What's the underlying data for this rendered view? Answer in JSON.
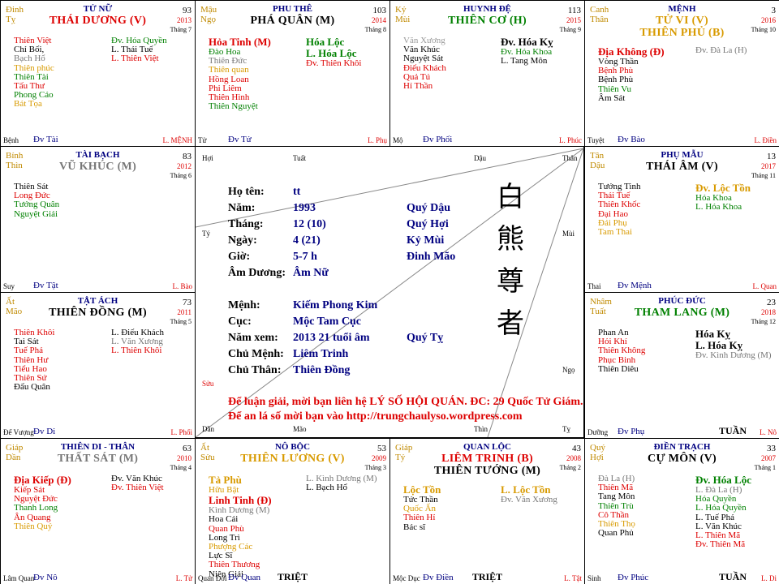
{
  "cells": [
    {
      "id": "tl",
      "can": [
        "Đinh",
        "Tỵ"
      ],
      "house": "TỬ NỮ",
      "main": [
        {
          "t": "THÁI DƯƠNG (V)",
          "c": "red"
        }
      ],
      "age": "93",
      "year": "2013",
      "month": "Tháng 7",
      "left": [
        {
          "t": "Thiên Việt",
          "c": "red"
        },
        {
          "t": "Chỉ Bối,",
          "c": "black"
        },
        {
          "t": "Bạch Hổ",
          "c": "gray"
        },
        {
          "t": "Thiên phúc",
          "c": "orange"
        },
        {
          "t": "Thiên Tài",
          "c": "green"
        },
        {
          "t": "Tấu Thư",
          "c": "red"
        },
        {
          "t": "Phong Cáo",
          "c": "green"
        },
        {
          "t": "Bát Tọa",
          "c": "orange"
        }
      ],
      "right": [
        {
          "t": "Đv. Hóa Quyền",
          "c": "green"
        },
        {
          "t": "L. Thái Tuế",
          "c": "black"
        },
        {
          "t": "L. Thiên Việt",
          "c": "red"
        }
      ],
      "foot": {
        "l": "Bệnh",
        "c": "Đv Tài",
        "r": "L. MỆNH",
        "tu": ""
      }
    },
    {
      "id": "t2",
      "can": [
        "Mậu",
        "Ngọ"
      ],
      "house": "PHU THÊ",
      "main": [
        {
          "t": "PHÁ QUÂN (M)",
          "c": "black"
        }
      ],
      "age": "103",
      "year": "2014",
      "month": "Tháng 8",
      "left": [
        {
          "t": "Hỏa Tinh (M)",
          "c": "red",
          "big": true
        },
        {
          "t": "Đào Hoa",
          "c": "green"
        },
        {
          "t": "Thiên Đức",
          "c": "gray"
        },
        {
          "t": "Thiên quan",
          "c": "orange"
        },
        {
          "t": "Hồng Loan",
          "c": "red"
        },
        {
          "t": "Phi Liêm",
          "c": "red"
        },
        {
          "t": "Thiên Hình",
          "c": "red"
        },
        {
          "t": "Thiên Nguyệt",
          "c": "green"
        }
      ],
      "right": [
        {
          "t": "Hóa Lộc",
          "c": "green",
          "big": true
        },
        {
          "t": "L. Hóa Lộc",
          "c": "green",
          "big": true
        },
        {
          "t": "Đv. Thiên Khôi",
          "c": "red"
        }
      ],
      "foot": {
        "l": "Tử",
        "c": "Đv Tử",
        "r": "L. Phụ",
        "tu": ""
      }
    },
    {
      "id": "t3",
      "can": [
        "Kỷ",
        "Mùi"
      ],
      "house": "HUYNH ĐỆ",
      "main": [
        {
          "t": "THIÊN CƠ (H)",
          "c": "green"
        }
      ],
      "age": "113",
      "year": "2015",
      "month": "Tháng 9",
      "left": [
        {
          "t": "Văn Xương",
          "c": "lgray",
          "big": false
        },
        {
          "t": "Văn Khúc",
          "c": "black"
        },
        {
          "t": "Nguyệt Sát",
          "c": "black"
        },
        {
          "t": "Điếu Khách",
          "c": "red"
        },
        {
          "t": "Quả Tú",
          "c": "red"
        },
        {
          "t": "Hỉ Thần",
          "c": "red"
        }
      ],
      "right": [
        {
          "t": "Đv. Hóa Kỵ",
          "c": "black",
          "big": true
        },
        {
          "t": "Đv. Hóa Khoa",
          "c": "green"
        },
        {
          "t": "L. Tang Môn",
          "c": "black"
        }
      ],
      "foot": {
        "l": "Mộ",
        "c": "Đv Phối",
        "r": "L. Phúc",
        "tu": ""
      }
    },
    {
      "id": "tr",
      "can": [
        "Canh",
        "Thân"
      ],
      "house": "MỆNH",
      "main": [
        {
          "t": "TỬ VI (V)",
          "c": "orange"
        },
        {
          "t": "THIÊN PHỦ (B)",
          "c": "orange"
        }
      ],
      "age": "3",
      "year": "2016",
      "month": "Tháng 10",
      "left": [
        {
          "t": "Địa Không (Đ)",
          "c": "red",
          "big": true
        },
        {
          "t": "Vòng Thần",
          "c": "black"
        },
        {
          "t": "Bệnh Phù",
          "c": "red"
        },
        {
          "t": "Bệnh Phù",
          "c": "black"
        },
        {
          "t": "Thiên Vu",
          "c": "green"
        },
        {
          "t": "Âm Sát",
          "c": "black"
        }
      ],
      "right": [
        {
          "t": "Đv. Đà La (H)",
          "c": "gray"
        }
      ],
      "foot": {
        "l": "Tuyệt",
        "c": "Đv Bào",
        "r": "L. Điền",
        "tu": ""
      }
    },
    {
      "id": "l2",
      "can": [
        "Bính",
        "Thìn"
      ],
      "house": "TÀI BẠCH",
      "main": [
        {
          "t": "VŨ KHÚC (M)",
          "c": "gray"
        }
      ],
      "age": "83",
      "year": "2012",
      "month": "Tháng 6",
      "left": [
        {
          "t": "Thiên Sát",
          "c": "black"
        },
        {
          "t": "Long Đức",
          "c": "red"
        },
        {
          "t": "Tướng Quân",
          "c": "green"
        },
        {
          "t": "Nguyệt Giải",
          "c": "green"
        }
      ],
      "right": [],
      "foot": {
        "l": "Suy",
        "c": "Đv Tật",
        "r": "L. Bào",
        "tu": ""
      }
    },
    {
      "id": "r2",
      "can": [
        "Tân",
        "Dậu"
      ],
      "house": "PHỤ MẪU",
      "main": [
        {
          "t": "THÁI ÂM (V)",
          "c": "black"
        }
      ],
      "age": "13",
      "year": "2017",
      "month": "Tháng 11",
      "left": [
        {
          "t": "Tướng Tinh",
          "c": "black"
        },
        {
          "t": "Thái Tuế",
          "c": "red"
        },
        {
          "t": "Thiên Khốc",
          "c": "red"
        },
        {
          "t": "Đại Hao",
          "c": "red"
        },
        {
          "t": "Đái Phụ",
          "c": "orange"
        },
        {
          "t": "Tam Thai",
          "c": "orange"
        }
      ],
      "right": [
        {
          "t": "Đv. Lộc Tồn",
          "c": "orange",
          "big": true
        },
        {
          "t": "Hóa Khoa",
          "c": "green"
        },
        {
          "t": "L. Hóa Khoa",
          "c": "green"
        }
      ],
      "foot": {
        "l": "Thai",
        "c": "Đv Mệnh",
        "r": "L. Quan",
        "tu": ""
      }
    },
    {
      "id": "l3",
      "can": [
        "Ất",
        "Mão"
      ],
      "house": "TẬT ÁCH",
      "main": [
        {
          "t": "THIÊN ĐỒNG (M)",
          "c": "black"
        }
      ],
      "age": "73",
      "year": "2011",
      "month": "Tháng 5",
      "left": [
        {
          "t": "Thiên Khôi",
          "c": "red"
        },
        {
          "t": "Tai Sát",
          "c": "black"
        },
        {
          "t": "Tuế Phá",
          "c": "red"
        },
        {
          "t": "Thiên Hư",
          "c": "red"
        },
        {
          "t": "Tiểu Hao",
          "c": "red"
        },
        {
          "t": "Thiên Sứ",
          "c": "red"
        },
        {
          "t": "Đẩu Quân",
          "c": "black"
        }
      ],
      "right": [
        {
          "t": "L. Điếu Khách",
          "c": "black"
        },
        {
          "t": "L. Văn Xương",
          "c": "gray"
        },
        {
          "t": "L. Thiên Khôi",
          "c": "red"
        }
      ],
      "foot": {
        "l": "Đế Vượng",
        "c": "Đv Di",
        "r": "L. Phối",
        "tu": ""
      }
    },
    {
      "id": "r3",
      "can": [
        "Nhâm",
        "Tuất"
      ],
      "house": "PHÚC ĐỨC",
      "main": [
        {
          "t": "THAM LANG (M)",
          "c": "green"
        }
      ],
      "age": "23",
      "year": "2018",
      "month": "Tháng 12",
      "left": [
        {
          "t": "Phan An",
          "c": "black"
        },
        {
          "t": "Hỏi Khí",
          "c": "red"
        },
        {
          "t": "Thiên Không",
          "c": "red"
        },
        {
          "t": "Phục Binh",
          "c": "red"
        },
        {
          "t": "Thiên Diêu",
          "c": "black"
        }
      ],
      "right": [
        {
          "t": "Hóa Kỵ",
          "c": "black",
          "big": true
        },
        {
          "t": "L. Hóa Kỵ",
          "c": "black",
          "big": true
        },
        {
          "t": "Đv. Kình Dương (M)",
          "c": "gray"
        }
      ],
      "foot": {
        "l": "Dưỡng",
        "c": "Đv Phụ",
        "r": "L. Nô",
        "tu": "TUẦN"
      }
    },
    {
      "id": "bl",
      "can": [
        "Giáp",
        "Dần"
      ],
      "house": "THIÊN DI - THÂN",
      "main": [
        {
          "t": "THẤT SÁT (M)",
          "c": "gray"
        }
      ],
      "age": "63",
      "year": "2010",
      "month": "Tháng 4",
      "left": [
        {
          "t": "Địa Kiếp (Đ)",
          "c": "red",
          "big": true
        },
        {
          "t": "Kiếp Sát",
          "c": "red"
        },
        {
          "t": "Nguyệt Đức",
          "c": "red"
        },
        {
          "t": "Thanh Long",
          "c": "green"
        },
        {
          "t": "Ân Quang",
          "c": "red"
        },
        {
          "t": "Thiên Quý",
          "c": "orange"
        }
      ],
      "right": [
        {
          "t": "Đv. Văn Khúc",
          "c": "black"
        },
        {
          "t": "Đv. Thiên Việt",
          "c": "red"
        }
      ],
      "foot": {
        "l": "Lâm Quan",
        "c": "Đv Nô",
        "r": "L. Tử",
        "tu": ""
      }
    },
    {
      "id": "b2",
      "can": [
        "Ất",
        "Sửu"
      ],
      "house": "NÔ BỘC",
      "main": [
        {
          "t": "THIÊN LƯƠNG (V)",
          "c": "orange"
        }
      ],
      "age": "53",
      "year": "2009",
      "month": "Tháng 3",
      "left": [
        {
          "t": "Tả Phù",
          "c": "orange",
          "big": true
        },
        {
          "t": "Hữu Bật",
          "c": "orange"
        },
        {
          "t": "Linh Tinh (Đ)",
          "c": "red",
          "big": true
        },
        {
          "t": "Kình Dương (M)",
          "c": "gray"
        },
        {
          "t": "Hoa Cái",
          "c": "black"
        },
        {
          "t": "Quan Phù",
          "c": "red"
        },
        {
          "t": "Long Trì",
          "c": "black"
        },
        {
          "t": "Phượng Các",
          "c": "orange"
        },
        {
          "t": "Lực Sĩ",
          "c": "black"
        },
        {
          "t": "Thiên Thương",
          "c": "red"
        },
        {
          "t": "Niên Giải",
          "c": "black"
        }
      ],
      "right": [
        {
          "t": "L. Kình Dương (M)",
          "c": "gray"
        },
        {
          "t": "L. Bạch Hổ",
          "c": "black"
        }
      ],
      "foot": {
        "l": "Quan Đới",
        "c": "Đv Quan",
        "r": "",
        "tu": "TRIỆT"
      }
    },
    {
      "id": "b3",
      "can": [
        "Giáp",
        "Tý"
      ],
      "house": "QUAN LỘC",
      "main": [
        {
          "t": "LIÊM TRINH (B)",
          "c": "red"
        },
        {
          "t": "THIÊN TƯỚNG (M)",
          "c": "black"
        }
      ],
      "age": "43",
      "year": "2008",
      "month": "Tháng 2",
      "left": [
        {
          "t": "Lộc Tồn",
          "c": "orange",
          "big": true
        },
        {
          "t": "Tức Thần",
          "c": "black"
        },
        {
          "t": "Quốc Ấn",
          "c": "orange"
        },
        {
          "t": "Thiên Hỉ",
          "c": "red"
        },
        {
          "t": "Bác sĩ",
          "c": "black"
        }
      ],
      "right": [
        {
          "t": "L. Lộc Tồn",
          "c": "orange",
          "big": true
        },
        {
          "t": "Đv. Văn Xương",
          "c": "gray"
        }
      ],
      "foot": {
        "l": "Mộc Dục",
        "c": "Đv Điền",
        "r": "L. Tật",
        "tu": "TRIỆT"
      }
    },
    {
      "id": "br",
      "can": [
        "Quý",
        "Hợi"
      ],
      "house": "ĐIỀN TRẠCH",
      "main": [
        {
          "t": "CỰ MÔN (V)",
          "c": "black"
        }
      ],
      "age": "33",
      "year": "2007",
      "month": "Tháng 1",
      "left": [
        {
          "t": "Đà La (H)",
          "c": "gray"
        },
        {
          "t": "Thiên Mã",
          "c": "red"
        },
        {
          "t": "Tang Môn",
          "c": "black"
        },
        {
          "t": "Thiên Trù",
          "c": "green"
        },
        {
          "t": "Cô Thần",
          "c": "red"
        },
        {
          "t": "Thiên Thọ",
          "c": "orange"
        },
        {
          "t": "Quan Phủ",
          "c": "black"
        }
      ],
      "right": [
        {
          "t": "Đv. Hóa Lộc",
          "c": "green",
          "big": true
        },
        {
          "t": "L. Đà La (H)",
          "c": "gray"
        },
        {
          "t": "Hóa Quyền",
          "c": "green"
        },
        {
          "t": "L. Hóa Quyền",
          "c": "green"
        },
        {
          "t": "L. Tuế Phá",
          "c": "black"
        },
        {
          "t": "L. Văn Khúc",
          "c": "black"
        },
        {
          "t": "L. Thiên Mã",
          "c": "red"
        },
        {
          "t": "Đv. Thiên Mã",
          "c": "red"
        }
      ],
      "foot": {
        "l": "Sinh",
        "c": "Đv Phúc",
        "r": "L. Di",
        "tu": "TUẦN"
      }
    }
  ],
  "center": {
    "corner_labels": {
      "hoi": "Hợi",
      "tuat": "Tuất",
      "dau": "Dậu",
      "than": "Thân",
      "ty": "Tý",
      "mui": "Mùi",
      "suu": "Sửu",
      "ngo": "Ngọ",
      "dan": "Dần",
      "mao": "Mão",
      "thin": "Thìn",
      "ty2": "Tỵ"
    },
    "info": [
      {
        "k": "Họ tên:",
        "v": "tt",
        "v2": ""
      },
      {
        "k": "Năm:",
        "v": "1993",
        "v2": "Quý Dậu"
      },
      {
        "k": "Tháng:",
        "v": "12 (10)",
        "v2": "Quý Hợi"
      },
      {
        "k": "Ngày:",
        "v": "4 (21)",
        "v2": "Kỷ Mùi"
      },
      {
        "k": "Giờ:",
        "v": "5-7 h",
        "v2": "Đinh Mão"
      },
      {
        "k": "Âm Dương:",
        "v": "Âm Nữ",
        "v2": ""
      },
      {
        "k": "Mệnh:",
        "v": "Kiếm Phong Kim",
        "v2": ""
      },
      {
        "k": "Cục:",
        "v": "Mộc Tam Cục",
        "v2": ""
      },
      {
        "k": "Năm xem:",
        "v": "2013  21 tuổi âm",
        "v2": "Quý Tỵ"
      },
      {
        "k": "Chủ Mệnh:",
        "v": "Liêm Trinh",
        "v2": ""
      },
      {
        "k": "Chủ Thân:",
        "v": "Thiên Đồng",
        "v2": ""
      }
    ],
    "calligraphy": [
      "白",
      "熊",
      "尊",
      "者"
    ],
    "notice1": "Để luận giải, mời bạn liên hệ LÝ SỐ HỘI QUÁN. ĐC: 29 Quốc Tử Giám.",
    "notice2": "Để an lá số mời bạn vào http://trungchaulyso.wordpress.com"
  }
}
